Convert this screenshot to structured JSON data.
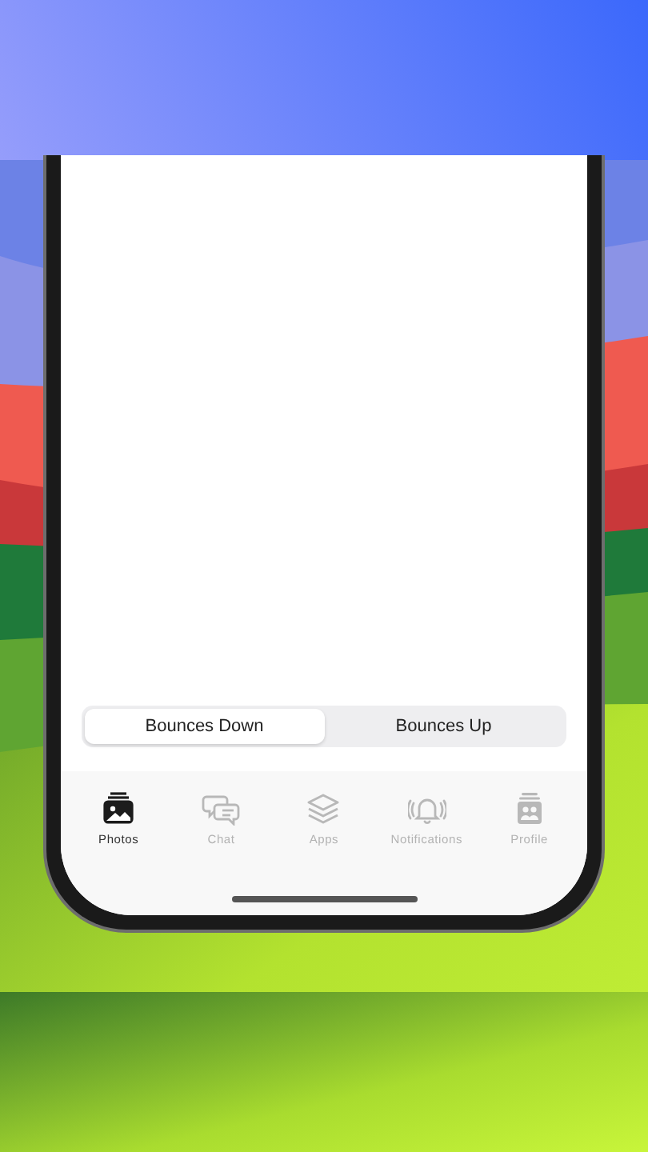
{
  "segmented_control": [
    {
      "label": "Bounces Down",
      "selected": true
    },
    {
      "label": "Bounces Up",
      "selected": false
    }
  ],
  "tab_bar": [
    {
      "label": "Photos",
      "kind": "photos",
      "selected": true
    },
    {
      "label": "Chat",
      "kind": "chat",
      "selected": false
    },
    {
      "label": "Apps",
      "kind": "apps",
      "selected": false
    },
    {
      "label": "Notifications",
      "kind": "notifications",
      "selected": false
    },
    {
      "label": "Profile",
      "kind": "profile",
      "selected": false
    }
  ]
}
